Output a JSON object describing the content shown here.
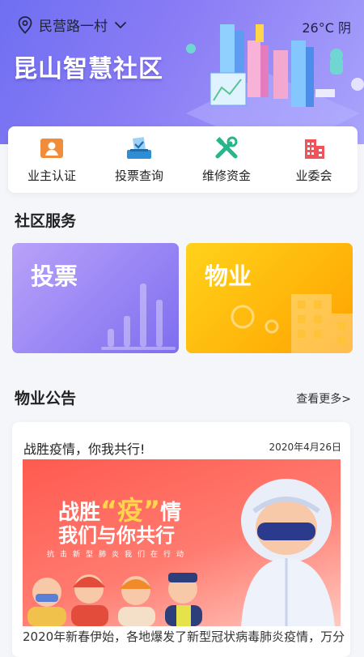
{
  "header": {
    "location": "民营路一村",
    "weather": "26°C 阴",
    "brand": "昆山智慧社区"
  },
  "quick_actions": [
    {
      "label": "业主认证",
      "icon": "owner-id-icon",
      "color": "#f08c3a"
    },
    {
      "label": "投票查询",
      "icon": "ballot-box-icon",
      "color": "#2d8ed6"
    },
    {
      "label": "维修资金",
      "icon": "tools-icon",
      "color": "#28b58a"
    },
    {
      "label": "业委会",
      "icon": "building-icon",
      "color": "#f0535a"
    }
  ],
  "services": {
    "title": "社区服务",
    "vote_label": "投票",
    "property_label": "物业"
  },
  "notices": {
    "title": "物业公告",
    "more_label": "查看更多>",
    "item": {
      "title": "战胜疫情，你我共行!",
      "date": "2020年4月26日",
      "banner_line1_a": "战胜",
      "banner_line1_b": "“疫”",
      "banner_line1_c": "情",
      "banner_line2": "我们与你共行",
      "banner_line3": "抗击新型肺炎我们在行动",
      "summary": "2020年新春伊始，各地爆发了新型冠状病毒肺炎疫情，万分"
    }
  }
}
